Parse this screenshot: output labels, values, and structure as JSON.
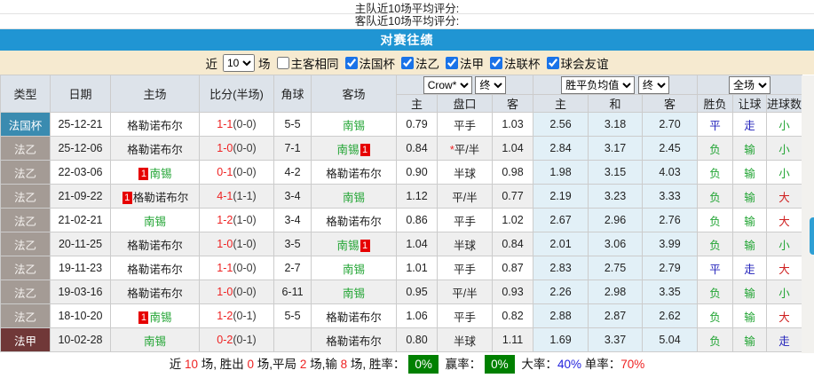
{
  "page": {
    "home_rating_label": "主队近10场平均评分:",
    "away_rating_label": "客队近10场平均评分:",
    "banner_title": "对赛往绩"
  },
  "filter": {
    "near_label": "近",
    "matches_value": "10",
    "matches_label": "场",
    "same_venue_label": "主客相同",
    "same_venue_checked": false,
    "competitions": [
      {
        "label": "法国杯",
        "checked": true
      },
      {
        "label": "法乙",
        "checked": true
      },
      {
        "label": "法甲",
        "checked": true
      },
      {
        "label": "法联杯",
        "checked": true
      },
      {
        "label": "球会友谊",
        "checked": true
      }
    ]
  },
  "table": {
    "headers": {
      "type": "类型",
      "date": "日期",
      "home": "主场",
      "score": "比分(半场)",
      "corner": "角球",
      "away": "客场",
      "odds_source_select": "Crow*",
      "odds_state_select": "终",
      "avg_select": "胜平负均值",
      "avg_state_select": "终",
      "scope_select": "全场",
      "sub": [
        "主",
        "盘口",
        "客",
        "主",
        "和",
        "客",
        "胜负",
        "让球",
        "进球数"
      ]
    },
    "rows": [
      {
        "type": "法国杯",
        "type_class": "type-cup",
        "date": "25-12-21",
        "home": {
          "name": "格勒诺布尔",
          "green": false,
          "badge": null
        },
        "score": {
          "ft": "1-1",
          "ht": "(0-0)"
        },
        "corner": "5-5",
        "away": {
          "name": "南锡",
          "green": true,
          "badge": null
        },
        "odds": {
          "home": "0.79",
          "handicap": "平手",
          "star": false,
          "away": "1.03"
        },
        "avg": {
          "home": "2.56",
          "draw": "3.18",
          "away": "2.70"
        },
        "result": {
          "outcome": "平",
          "outcome_color": "blue",
          "handicap": "走",
          "handicap_color": "blue",
          "goals": "小",
          "goals_color": "green"
        }
      },
      {
        "type": "法乙",
        "type_class": "type-l2",
        "date": "25-12-06",
        "home": {
          "name": "格勒诺布尔",
          "green": false,
          "badge": null
        },
        "score": {
          "ft": "1-0",
          "ht": "(0-0)"
        },
        "corner": "7-1",
        "away": {
          "name": "南锡",
          "green": true,
          "badge": "after"
        },
        "odds": {
          "home": "0.84",
          "handicap": "平/半",
          "star": true,
          "away": "1.04"
        },
        "avg": {
          "home": "2.84",
          "draw": "3.17",
          "away": "2.45"
        },
        "result": {
          "outcome": "负",
          "outcome_color": "green",
          "handicap": "输",
          "handicap_color": "green",
          "goals": "小",
          "goals_color": "green"
        }
      },
      {
        "type": "法乙",
        "type_class": "type-l2",
        "date": "22-03-06",
        "home": {
          "name": "南锡",
          "green": true,
          "badge": "before"
        },
        "score": {
          "ft": "0-1",
          "ht": "(0-0)"
        },
        "corner": "4-2",
        "away": {
          "name": "格勒诺布尔",
          "green": false,
          "badge": null
        },
        "odds": {
          "home": "0.90",
          "handicap": "半球",
          "star": false,
          "away": "0.98"
        },
        "avg": {
          "home": "1.98",
          "draw": "3.15",
          "away": "4.03"
        },
        "result": {
          "outcome": "负",
          "outcome_color": "green",
          "handicap": "输",
          "handicap_color": "green",
          "goals": "小",
          "goals_color": "green"
        }
      },
      {
        "type": "法乙",
        "type_class": "type-l2",
        "date": "21-09-22",
        "home": {
          "name": "格勒诺布尔",
          "green": false,
          "badge": "before"
        },
        "score": {
          "ft": "4-1",
          "ht": "(1-1)"
        },
        "corner": "3-4",
        "away": {
          "name": "南锡",
          "green": true,
          "badge": null
        },
        "odds": {
          "home": "1.12",
          "handicap": "平/半",
          "star": false,
          "away": "0.77"
        },
        "avg": {
          "home": "2.19",
          "draw": "3.23",
          "away": "3.33"
        },
        "result": {
          "outcome": "负",
          "outcome_color": "green",
          "handicap": "输",
          "handicap_color": "green",
          "goals": "大",
          "goals_color": "red"
        }
      },
      {
        "type": "法乙",
        "type_class": "type-l2",
        "date": "21-02-21",
        "home": {
          "name": "南锡",
          "green": true,
          "badge": null
        },
        "score": {
          "ft": "1-2",
          "ht": "(1-0)"
        },
        "corner": "3-4",
        "away": {
          "name": "格勒诺布尔",
          "green": false,
          "badge": null
        },
        "odds": {
          "home": "0.86",
          "handicap": "平手",
          "star": false,
          "away": "1.02"
        },
        "avg": {
          "home": "2.67",
          "draw": "2.96",
          "away": "2.76"
        },
        "result": {
          "outcome": "负",
          "outcome_color": "green",
          "handicap": "输",
          "handicap_color": "green",
          "goals": "大",
          "goals_color": "red"
        }
      },
      {
        "type": "法乙",
        "type_class": "type-l2",
        "date": "20-11-25",
        "home": {
          "name": "格勒诺布尔",
          "green": false,
          "badge": null
        },
        "score": {
          "ft": "1-0",
          "ht": "(1-0)"
        },
        "corner": "3-5",
        "away": {
          "name": "南锡",
          "green": true,
          "badge": "after"
        },
        "odds": {
          "home": "1.04",
          "handicap": "半球",
          "star": false,
          "away": "0.84"
        },
        "avg": {
          "home": "2.01",
          "draw": "3.06",
          "away": "3.99"
        },
        "result": {
          "outcome": "负",
          "outcome_color": "green",
          "handicap": "输",
          "handicap_color": "green",
          "goals": "小",
          "goals_color": "green"
        }
      },
      {
        "type": "法乙",
        "type_class": "type-l2",
        "date": "19-11-23",
        "home": {
          "name": "格勒诺布尔",
          "green": false,
          "badge": null
        },
        "score": {
          "ft": "1-1",
          "ht": "(0-0)"
        },
        "corner": "2-7",
        "away": {
          "name": "南锡",
          "green": true,
          "badge": null
        },
        "odds": {
          "home": "1.01",
          "handicap": "平手",
          "star": false,
          "away": "0.87"
        },
        "avg": {
          "home": "2.83",
          "draw": "2.75",
          "away": "2.79"
        },
        "result": {
          "outcome": "平",
          "outcome_color": "blue",
          "handicap": "走",
          "handicap_color": "blue",
          "goals": "大",
          "goals_color": "red"
        }
      },
      {
        "type": "法乙",
        "type_class": "type-l2",
        "date": "19-03-16",
        "home": {
          "name": "格勒诺布尔",
          "green": false,
          "badge": null
        },
        "score": {
          "ft": "1-0",
          "ht": "(0-0)"
        },
        "corner": "6-11",
        "away": {
          "name": "南锡",
          "green": true,
          "badge": null
        },
        "odds": {
          "home": "0.95",
          "handicap": "平/半",
          "star": false,
          "away": "0.93"
        },
        "avg": {
          "home": "2.26",
          "draw": "2.98",
          "away": "3.35"
        },
        "result": {
          "outcome": "负",
          "outcome_color": "green",
          "handicap": "输",
          "handicap_color": "green",
          "goals": "小",
          "goals_color": "green"
        }
      },
      {
        "type": "法乙",
        "type_class": "type-l2",
        "date": "18-10-20",
        "home": {
          "name": "南锡",
          "green": true,
          "badge": "before"
        },
        "score": {
          "ft": "1-2",
          "ht": "(0-1)"
        },
        "corner": "5-5",
        "away": {
          "name": "格勒诺布尔",
          "green": false,
          "badge": null
        },
        "odds": {
          "home": "1.06",
          "handicap": "平手",
          "star": false,
          "away": "0.82"
        },
        "avg": {
          "home": "2.88",
          "draw": "2.87",
          "away": "2.62"
        },
        "result": {
          "outcome": "负",
          "outcome_color": "green",
          "handicap": "输",
          "handicap_color": "green",
          "goals": "大",
          "goals_color": "red"
        }
      },
      {
        "type": "法甲",
        "type_class": "type-l1",
        "date": "10-02-28",
        "home": {
          "name": "南锡",
          "green": true,
          "badge": null
        },
        "score": {
          "ft": "0-2",
          "ht": "(0-1)"
        },
        "corner": "",
        "away": {
          "name": "格勒诺布尔",
          "green": false,
          "badge": null
        },
        "odds": {
          "home": "0.80",
          "handicap": "半球",
          "star": false,
          "away": "1.11"
        },
        "avg": {
          "home": "1.69",
          "draw": "3.37",
          "away": "5.04"
        },
        "result": {
          "outcome": "负",
          "outcome_color": "green",
          "handicap": "输",
          "handicap_color": "green",
          "goals": "走",
          "goals_color": "blue"
        }
      }
    ]
  },
  "summary": {
    "segments": [
      {
        "text": "近 ",
        "style": "normal"
      },
      {
        "text": "10",
        "style": "red"
      },
      {
        "text": " 场, 胜出 ",
        "style": "normal"
      },
      {
        "text": "0",
        "style": "red"
      },
      {
        "text": " 场,平局 ",
        "style": "normal"
      },
      {
        "text": "2",
        "style": "red"
      },
      {
        "text": " 场,输 ",
        "style": "normal"
      },
      {
        "text": "8",
        "style": "red"
      },
      {
        "text": " 场, 胜率：",
        "style": "normal"
      },
      {
        "text": "0%",
        "style": "greenbox"
      },
      {
        "text": " 赢率：",
        "style": "normal"
      },
      {
        "text": "0%",
        "style": "greenbox"
      },
      {
        "text": " 大率：",
        "style": "normal"
      },
      {
        "text": "40%",
        "style": "blue"
      },
      {
        "text": " 单率：",
        "style": "normal"
      },
      {
        "text": "70%",
        "style": "red"
      }
    ]
  },
  "colors": {
    "banner_blue": "#2095d3",
    "filter_beige": "#f6ead0",
    "header_gray": "#dde3ea",
    "cup_teal": "#3a8bb0",
    "league2_taupe": "#a49b95",
    "league1_maroon": "#703838",
    "team_green": "#21a433",
    "score_red": "#ee2222",
    "result_green": "#21a433",
    "result_blue": "#2323bb",
    "result_red": "#cf2121",
    "avg_col_blue": "#e2f0f7",
    "rate_box_green": "#008000",
    "alt_row_gray": "#efefef"
  }
}
